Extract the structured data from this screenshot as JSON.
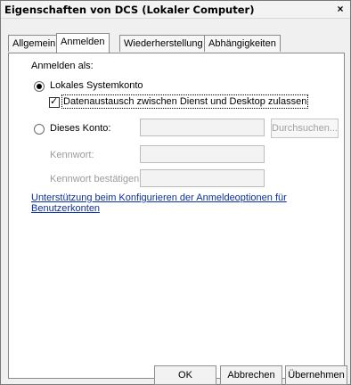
{
  "window": {
    "title": "Eigenschaften von DCS (Lokaler Computer)",
    "close_glyph": "×"
  },
  "tabs": [
    {
      "label": "Allgemein"
    },
    {
      "label": "Anmelden",
      "active": true
    },
    {
      "label": "Wiederherstellung"
    },
    {
      "label": "Abhängigkeiten"
    }
  ],
  "logon": {
    "heading": "Anmelden als:",
    "local_system": {
      "label": "Lokales Systemkonto",
      "selected": true
    },
    "desktop_interaction": {
      "label": "Datenaustausch zwischen Dienst und Desktop zulassen",
      "checked": true
    },
    "this_account": {
      "label": "Dieses Konto:",
      "selected": false,
      "value": "",
      "browse_label": "Durchsuchen..."
    },
    "password": {
      "label": "Kennwort:",
      "value": ""
    },
    "confirm_password": {
      "label": "Kennwort bestätigen:",
      "value": ""
    },
    "help_link": "Unterstützung beim Konfigurieren der Anmeldeoptionen für Benutzerkonten"
  },
  "footer": {
    "ok": "OK",
    "cancel": "Abbrechen",
    "apply": "Übernehmen"
  }
}
